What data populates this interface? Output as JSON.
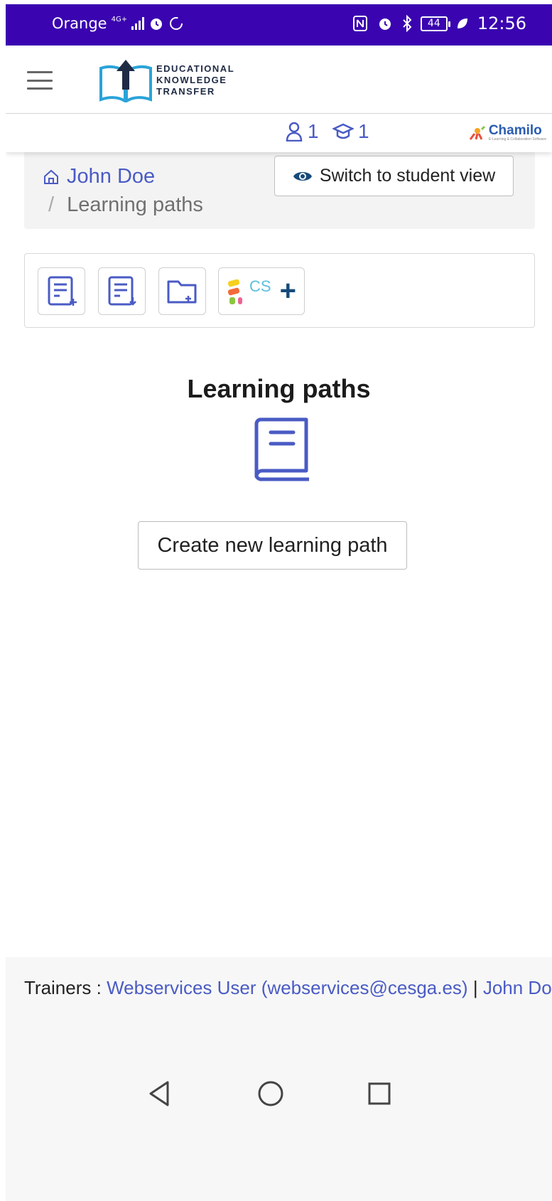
{
  "status_bar": {
    "carrier": "Orange",
    "network": "4G+",
    "battery": "44",
    "time": "12:56"
  },
  "header": {
    "logo_line1": "EDUCATIONAL",
    "logo_line2": "KNOWLEDGE",
    "logo_line3": "TRANSFER"
  },
  "counters": {
    "users": "1",
    "courses": "1"
  },
  "brand": {
    "name": "Chamilo",
    "tagline": "E-Learning & Collaboration Software"
  },
  "breadcrumb": {
    "home": "John Doe",
    "separator": "/",
    "current": "Learning paths"
  },
  "student_view_button": "Switch to student view",
  "toolbar": {
    "cs_label": "CS",
    "plus": "+"
  },
  "main": {
    "title": "Learning paths",
    "create_button": "Create new learning path"
  },
  "footer": {
    "trainers_label": "Trainers :",
    "trainer1": "Webservices User (webservices@cesga.es)",
    "divider": "|",
    "trainer2": "John Doe"
  },
  "colors": {
    "status_bar": "#3a04b0",
    "accent": "#4a5bc4",
    "chamilo_blue": "#2a5db0"
  }
}
